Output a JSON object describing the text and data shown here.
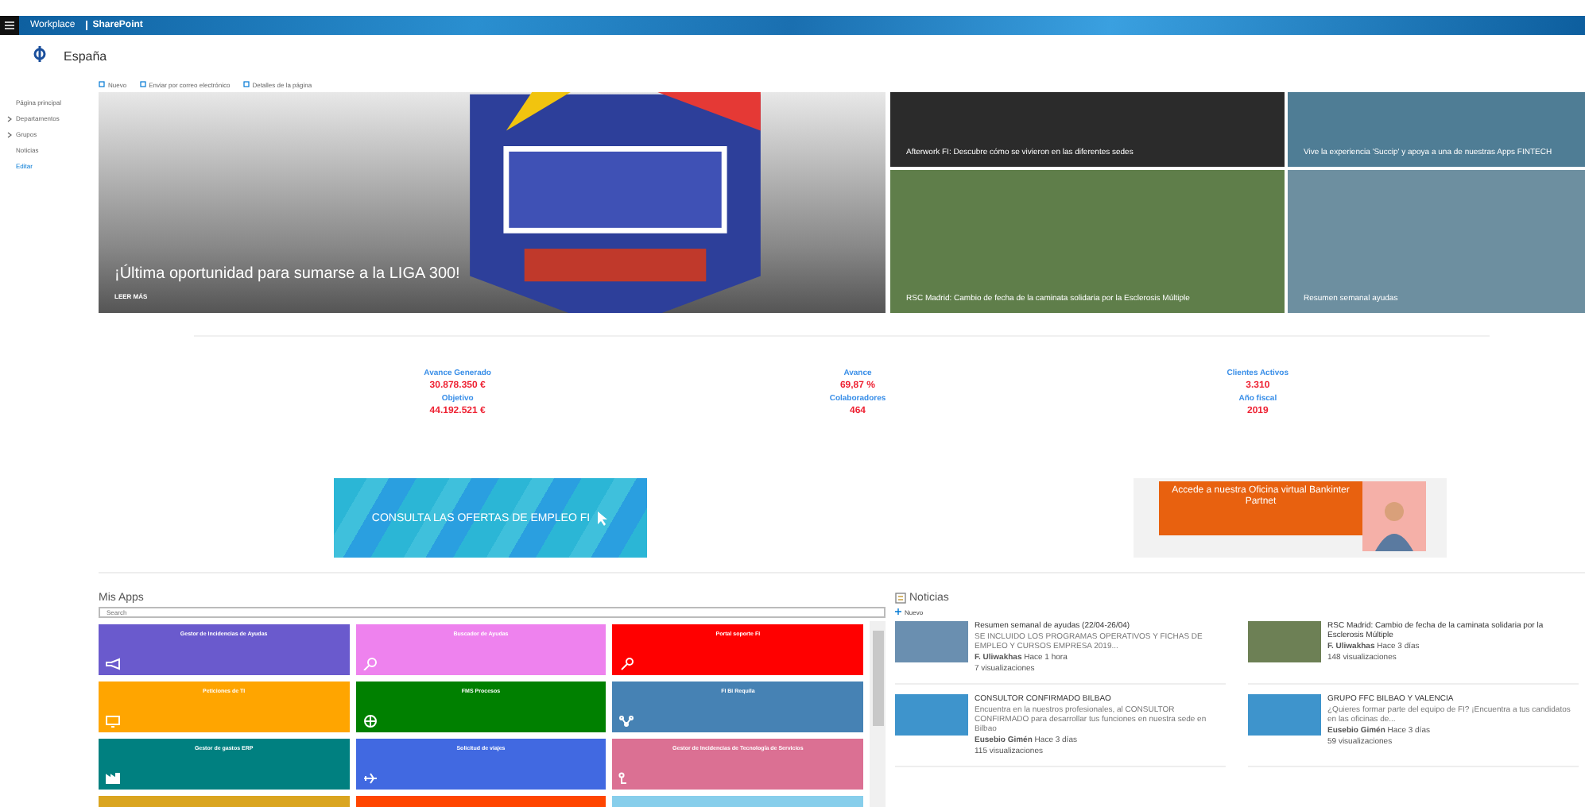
{
  "suite_bar": {
    "brand": "Workplace",
    "site": "SharePoint"
  },
  "site_header": {
    "title": "España"
  },
  "nav": [
    {
      "label": "Página principal",
      "expandable": false,
      "selected": false
    },
    {
      "label": "Departamentos",
      "expandable": true,
      "selected": false
    },
    {
      "label": "Grupos",
      "expandable": true,
      "selected": false
    },
    {
      "label": "Noticias",
      "expandable": false,
      "selected": false
    },
    {
      "label": "Editar",
      "expandable": false,
      "selected": true
    }
  ],
  "command_bar": [
    "Nuevo",
    "Enviar por correo electrónico",
    "Detalles de la página"
  ],
  "hero": {
    "title": "¡Última oportunidad para sumarse a la LIGA 300!",
    "link": "LEER MÁS"
  },
  "news_tiles": [
    {
      "title": "Afterwork FI: Descubre cómo se vivieron en las diferentes sedes"
    },
    {
      "title": "Vive la experiencia 'Succip' y apoya a una de nuestras Apps FINTECH"
    },
    {
      "title": "RSC Madrid: Cambio de fecha de la caminata solidaria por la Esclerosis Múltiple"
    },
    {
      "title": "Resumen semanal ayudas"
    }
  ],
  "stats": [
    {
      "label": "Avance Generado",
      "value": "30.878.350 €"
    },
    {
      "label": "Objetivo",
      "value": "44.192.521 €"
    },
    {
      "label": "Avance",
      "value": "69,87 %"
    },
    {
      "label": "Colaboradores",
      "value": "464"
    },
    {
      "label": "Clientes Activos",
      "value": "3.310"
    },
    {
      "label": "Año fiscal",
      "value": "2019"
    }
  ],
  "banners": {
    "jobs": "CONSULTA LAS OFERTAS DE EMPLEO FI",
    "office": "Accede a nuestra Oficina virtual Bankinter Partnet"
  },
  "apps": {
    "title": "Mis Apps",
    "search": {
      "placeholder": "Search"
    },
    "tiles": [
      {
        "title": "Gestor de Incidencias de Ayudas",
        "color": "#6a5acd"
      },
      {
        "title": "Buscador de Ayudas",
        "color": "#ee82ee"
      },
      {
        "title": "Portal soporte FI",
        "color": "#ff0000"
      },
      {
        "title": "Peticiones de TI",
        "color": "#ffa500"
      },
      {
        "title": "FMS Procesos",
        "color": "#008000"
      },
      {
        "title": "FI Bi Requila",
        "color": "#4682b4"
      },
      {
        "title": "Gestor de gastos ERP",
        "color": "#008080"
      },
      {
        "title": "Solicitud de viajes",
        "color": "#4169e1"
      },
      {
        "title": "Gestor de Incidencias de Tecnología de Servicios",
        "color": "#db7093"
      },
      {
        "color": "#daa520"
      },
      {
        "color": "#ff4500"
      },
      {
        "color": "#87ceeb"
      }
    ]
  },
  "news": {
    "title": "Noticias",
    "new_button": "Nuevo",
    "items": [
      {
        "title": "Resumen semanal de ayudas (22/04-26/04)",
        "excerpt": "SE INCLUIDO LOS PROGRAMAS OPERATIVOS Y FICHAS DE EMPLEO Y CURSOS EMPRESA 2019...",
        "author": "F. Uliwakhas",
        "time": "Hace 1 hora",
        "views": "7 visualizaciones"
      },
      {
        "title": "RSC Madrid: Cambio de fecha de la caminata solidaria por la Esclerosis Múltiple",
        "author": "F. Uliwakhas",
        "time": "Hace 3 días",
        "views": "148 visualizaciones"
      },
      {
        "title": "CONSULTOR CONFIRMADO BILBAO",
        "excerpt": "Encuentra en la nuestros profesionales, al CONSULTOR CONFIRMADO para desarrollar tus funciones en nuestra sede en Bilbao",
        "author": "Eusebio Gimén",
        "time": "Hace 3 días",
        "views": "115 visualizaciones"
      },
      {
        "title": "GRUPO FFC BILBAO Y VALENCIA",
        "excerpt": "¿Quieres formar parte del equipo de FI? ¡Encuentra a tus candidatos en las oficinas de...",
        "author": "Eusebio Gimén",
        "time": "Hace 3 días",
        "views": "59 visualizaciones"
      }
    ]
  }
}
